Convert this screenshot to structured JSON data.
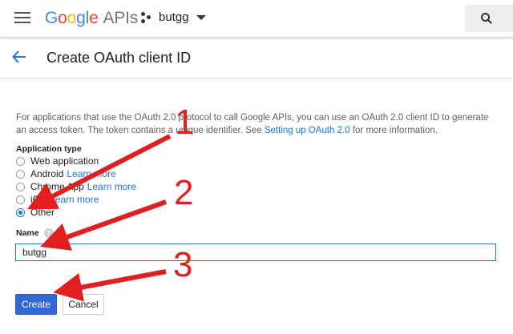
{
  "topbar": {
    "logo_letters": [
      "G",
      "o",
      "o",
      "g",
      "l",
      "e"
    ],
    "logo_suffix": "APIs",
    "project_name": "butgg",
    "icons": [
      "menu-icon",
      "project-dots-icon",
      "caret-down-icon",
      "search-icon"
    ]
  },
  "header": {
    "back_icon": "arrow-back-icon",
    "title": "Create OAuth client ID"
  },
  "intro": {
    "text_before_link": "For applications that use the OAuth 2.0 protocol to call Google APIs, you can use an OAuth 2.0 client ID to generate an access token. The token contains a unique identifier. See ",
    "link": "Setting up OAuth 2.0",
    "text_after_link": " for more information."
  },
  "application_type": {
    "label": "Application type",
    "options": [
      {
        "label": "Web application",
        "learn_more": "",
        "checked": false
      },
      {
        "label": "Android",
        "learn_more": "Learn more",
        "checked": false
      },
      {
        "label": "Chrome App",
        "learn_more": "Learn more",
        "checked": false
      },
      {
        "label": "iOS",
        "learn_more": "Learn more",
        "checked": false
      },
      {
        "label": "Other",
        "learn_more": "",
        "checked": true
      }
    ]
  },
  "name_field": {
    "label": "Name",
    "help_icon": "?",
    "value": "butgg"
  },
  "buttons": {
    "create": "Create",
    "cancel": "Cancel"
  },
  "annotations": {
    "color": "#e02020",
    "numbers": [
      "1",
      "2",
      "3"
    ]
  },
  "colors": {
    "primary": "#1a73e8",
    "create_button": "#3367d6",
    "annotation": "#e02020"
  }
}
